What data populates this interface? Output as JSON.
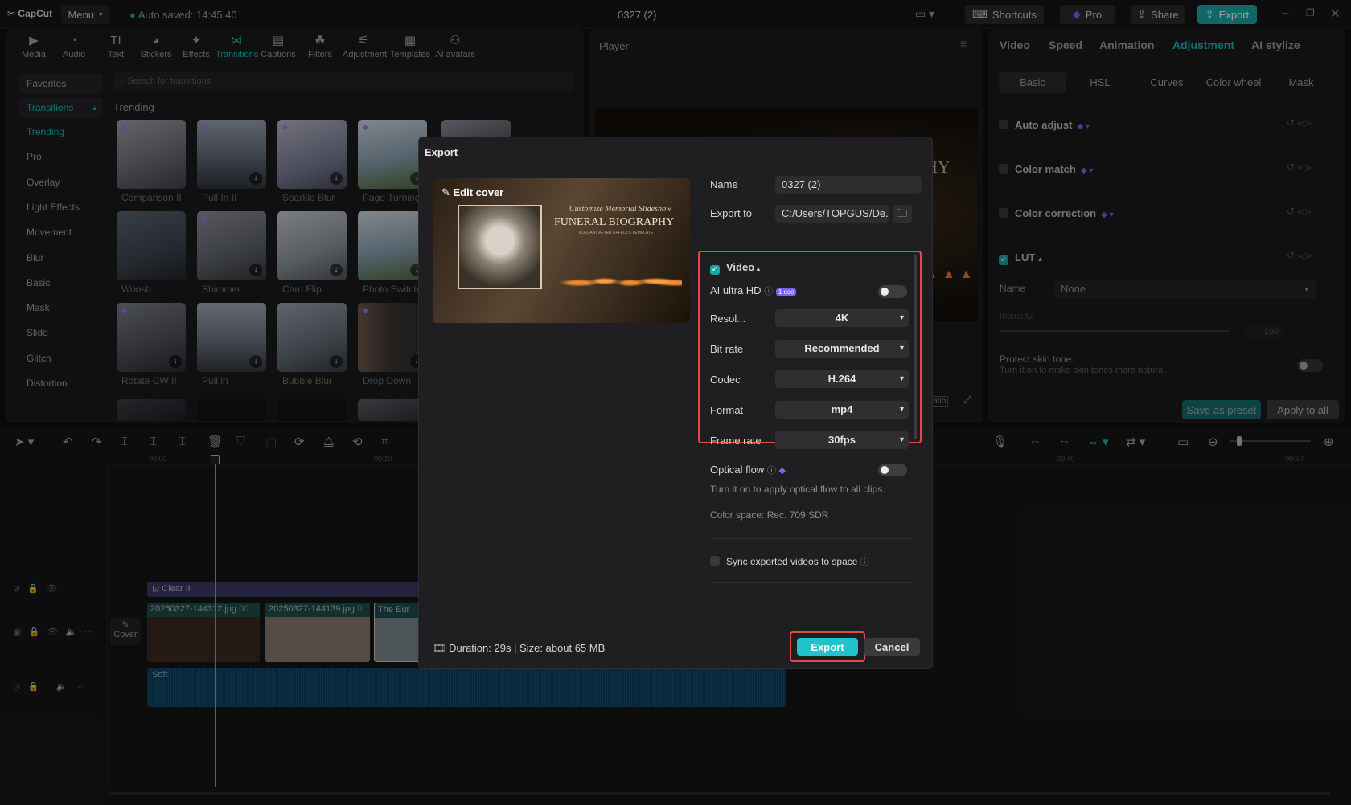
{
  "app": {
    "logo": "CapCut",
    "menu_label": "Menu",
    "autosave": "Auto saved: 14:45:40",
    "project_title": "0327 (2)",
    "shortcuts_label": "Shortcuts",
    "pro_label": "Pro",
    "share_label": "Share",
    "export_label": "Export"
  },
  "toolbar": {
    "items": [
      {
        "label": "Media",
        "icon": "media-icon"
      },
      {
        "label": "Audio",
        "icon": "audio-icon"
      },
      {
        "label": "Text",
        "icon": "text-icon"
      },
      {
        "label": "Stickers",
        "icon": "stickers-icon"
      },
      {
        "label": "Effects",
        "icon": "effects-icon"
      },
      {
        "label": "Transitions",
        "icon": "transitions-icon"
      },
      {
        "label": "Captions",
        "icon": "captions-icon"
      },
      {
        "label": "Filters",
        "icon": "filters-icon"
      },
      {
        "label": "Adjustment",
        "icon": "adjustment-icon"
      },
      {
        "label": "Templates",
        "icon": "templates-icon"
      },
      {
        "label": "AI avatars",
        "icon": "ai-avatars-icon"
      }
    ]
  },
  "library": {
    "favorites": "Favorites",
    "transitions": "Transitions",
    "search_placeholder": "Search for transitions",
    "section_title": "Trending",
    "categories": [
      "Trending",
      "Pro",
      "Overlay",
      "Light Effects",
      "Movement",
      "Blur",
      "Basic",
      "Mask",
      "Slide",
      "Glitch",
      "Distortion"
    ],
    "thumbs": [
      "Comparison II",
      "Pull In II",
      "Sparkle Blur",
      "Page Turning",
      "Woosh",
      "Shimmer",
      "Card Flip",
      "Photo Switch",
      "Rotate CW II",
      "Pull in",
      "Bubble Blur",
      "Drop Down"
    ]
  },
  "player": {
    "title": "Player",
    "ratio_label": "Ratio",
    "bg_text": "HY"
  },
  "right_panel": {
    "tabs": [
      "Video",
      "Speed",
      "Animation",
      "Adjustment",
      "AI stylize"
    ],
    "subtabs": [
      "Basic",
      "HSL",
      "Curves",
      "Color wheel",
      "Mask"
    ],
    "rows": [
      "Auto adjust",
      "Color match",
      "Color correction",
      "LUT"
    ],
    "lut_name_label": "Name",
    "lut_name_value": "None",
    "intensity_label": "Intensity",
    "intensity_value": "100",
    "protect_title": "Protect skin tone",
    "protect_desc": "Turn it on to make skin tones more natural.",
    "save_preset": "Save as preset",
    "apply_all": "Apply to all"
  },
  "timeline": {
    "ticks": [
      "00:00",
      "00:10",
      "00:40",
      "00:50"
    ],
    "effect_clip": "Clear II",
    "clip1": "20250327-144312.jpg",
    "clip1_dur": "00:",
    "clip2": "20250327-144139.jpg",
    "clip2_dur": "0",
    "clip3": "The Eur",
    "cover_label": "Cover",
    "audio_label": "Soft"
  },
  "dialog": {
    "title": "Export",
    "edit_cover": "Edit cover",
    "cover_script": "Customize Memorial Slideshow",
    "cover_title": "FUNERAL BIOGRAPHY",
    "cover_sub": "ELEGANT AFTER EFFECTS TEMPLATE",
    "name_label": "Name",
    "name_value": "0327 (2)",
    "export_to_label": "Export to",
    "export_to_value": "C:/Users/TOPGUS/De...",
    "video_section": "Video",
    "ai_hd_label": "AI ultra HD",
    "ai_hd_badge": "1 use",
    "resolution_label": "Resol...",
    "resolution_value": "4K",
    "bitrate_label": "Bit rate",
    "bitrate_value": "Recommended",
    "codec_label": "Codec",
    "codec_value": "H.264",
    "format_label": "Format",
    "format_value": "mp4",
    "framerate_label": "Frame rate",
    "framerate_value": "30fps",
    "optical_label": "Optical flow",
    "optical_desc": "Turn it on to apply optical flow to all clips.",
    "color_space": "Color space: Rec. 709 SDR",
    "sync_label": "Sync exported videos to space",
    "duration_size": "Duration: 29s | Size: about 65 MB",
    "export_button": "Export",
    "cancel_button": "Cancel"
  },
  "colors": {
    "accent": "#19a7a8",
    "highlight": "#e04b4b",
    "pro": "#7b61ff"
  }
}
